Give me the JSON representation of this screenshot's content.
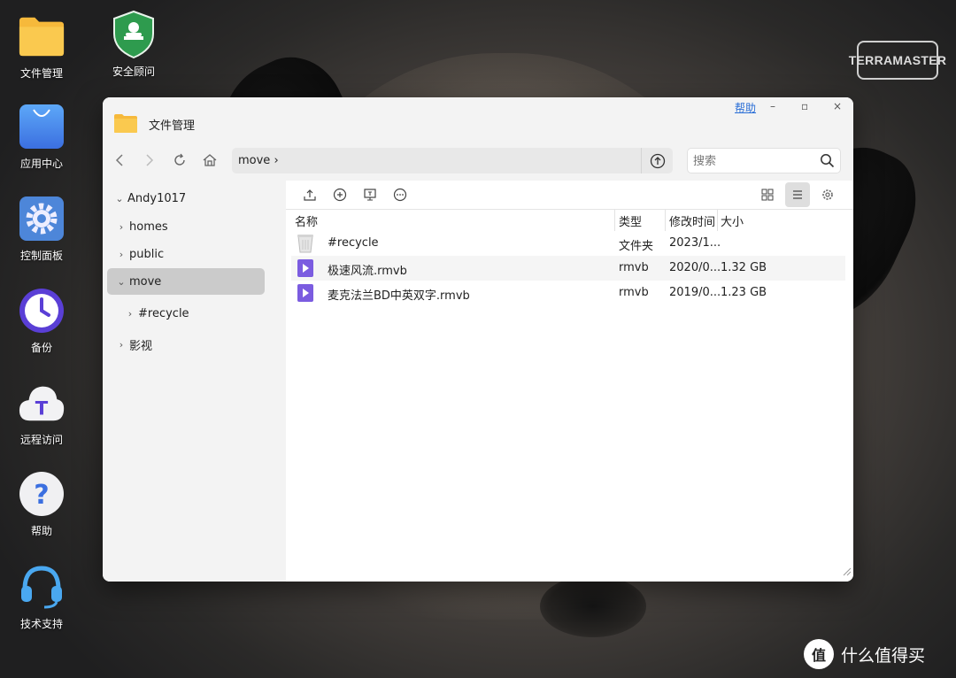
{
  "desktop": {
    "icons": [
      {
        "label": "文件管理",
        "icon": "folder-icon"
      },
      {
        "label": "安全顾问",
        "icon": "shield-icon"
      },
      {
        "label": "应用中心",
        "icon": "shopping-bag-icon"
      },
      {
        "label": "控制面板",
        "icon": "gear-icon"
      },
      {
        "label": "备份",
        "icon": "clock-icon"
      },
      {
        "label": "远程访问",
        "icon": "cloud-icon"
      },
      {
        "label": "帮助",
        "icon": "question-icon"
      },
      {
        "label": "技术支持",
        "icon": "headset-icon"
      }
    ],
    "brand": "TERRAMASTER",
    "watermark": {
      "badge": "值",
      "text": "什么值得买"
    }
  },
  "window": {
    "title": "文件管理",
    "help": "帮助",
    "controls": {
      "minimize": "–",
      "maximize": "▫",
      "close": "×"
    },
    "path": "move",
    "search_placeholder": "搜索"
  },
  "sidebar": {
    "root": "Andy1017",
    "items": [
      {
        "label": "homes"
      },
      {
        "label": "public"
      },
      {
        "label": "move"
      },
      {
        "label": "#recycle"
      },
      {
        "label": "影视"
      }
    ]
  },
  "table": {
    "columns": [
      "名称",
      "类型",
      "修改时间",
      "大小"
    ],
    "rows": [
      {
        "name": "#recycle",
        "type": "文件夹",
        "time": "2023/1...",
        "size": "",
        "icon": "trash-icon"
      },
      {
        "name": "极速风流.rmvb",
        "type": "rmvb",
        "time": "2020/0...",
        "size": "1.32 GB",
        "icon": "video-file-icon"
      },
      {
        "name": "麦克法兰BD中英双字.rmvb",
        "type": "rmvb",
        "time": "2019/0...",
        "size": "1.23 GB",
        "icon": "video-file-icon"
      }
    ]
  },
  "colors": {
    "accent": "#2a6ed6",
    "folder": "#f8c53c",
    "video": "#7b5ce0"
  }
}
